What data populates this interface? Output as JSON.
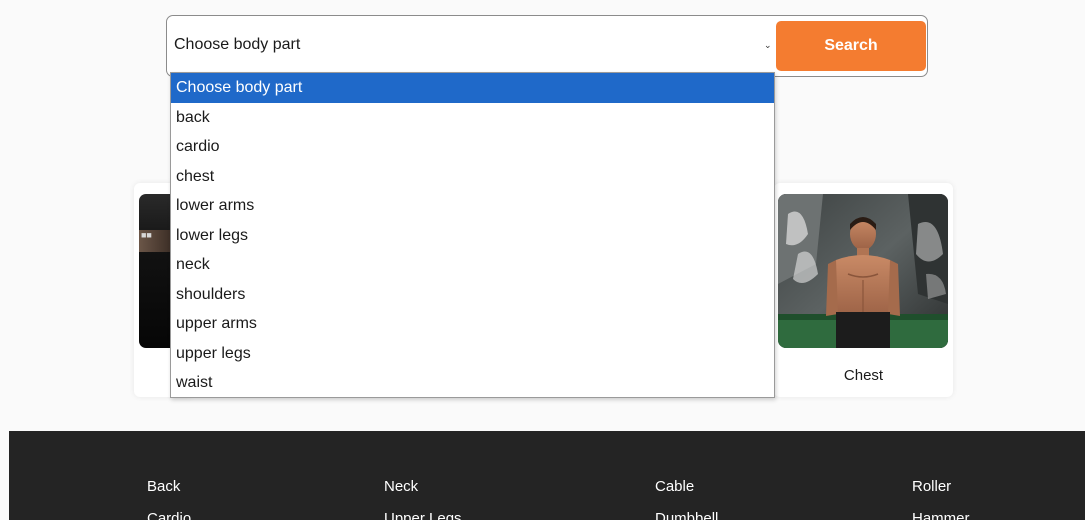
{
  "search": {
    "select_value": "Choose body part",
    "button_label": "Search"
  },
  "dropdown": {
    "options": [
      "Choose body part",
      "back",
      "cardio",
      "chest",
      "lower arms",
      "lower legs",
      "neck",
      "shoulders",
      "upper arms",
      "upper legs",
      "waist"
    ],
    "selected_index": 0
  },
  "cards": {
    "right_label": "Chest"
  },
  "footer": {
    "columns": [
      [
        "Back",
        "Cardio"
      ],
      [
        "Neck",
        "Upper Legs"
      ],
      [
        "Cable",
        "Dumbbell"
      ],
      [
        "Roller",
        "Hammer"
      ]
    ]
  },
  "colors": {
    "accent": "#f47c30",
    "selected_option": "#1f69c9",
    "footer_bg": "#242424"
  }
}
